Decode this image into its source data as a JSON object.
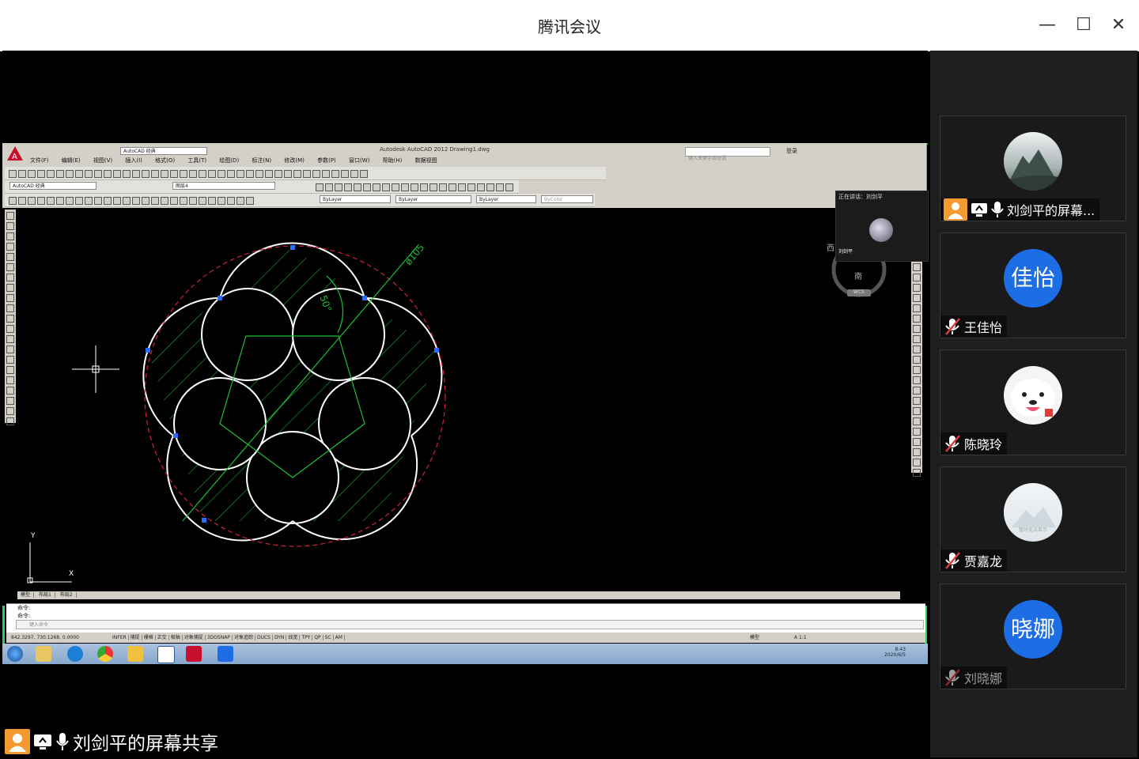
{
  "window": {
    "title": "腾讯会议",
    "controls": {
      "minimize": "—",
      "maximize": "☐",
      "close": "✕"
    }
  },
  "share": {
    "sharer_label": "刘剑平的屏幕共享",
    "speaking_label": "正在讲话：刘剑平",
    "mini_name": "刘剑平"
  },
  "autocad": {
    "logo_letter": "A",
    "workspace": "AutoCAD 经典",
    "title": "Autodesk AutoCAD 2012    Drawing1.dwg",
    "search_placeholder": "键入关键字或短语",
    "signin": "登录",
    "menu": [
      "文件(F)",
      "编辑(E)",
      "视图(V)",
      "插入(I)",
      "格式(O)",
      "工具(T)",
      "绘图(D)",
      "标注(N)",
      "修改(M)",
      "参数(P)",
      "窗口(W)",
      "帮助(H)",
      "数据视图"
    ],
    "workspace_combo": "AutoCAD 经典",
    "layer_combo": "图层4",
    "color_combo": "ByLayer",
    "linetype_combo": "ByLayer",
    "lineweight_combo": "ByLayer",
    "plotstyle_combo": "ByColor",
    "dimension_text_1": "ø105",
    "dimension_text_2": "50°",
    "viewcube_west": "西",
    "viewcube_south": "南",
    "wcs_label": "WCS",
    "ucs_y": "Y",
    "ucs_x": "X",
    "layout_tabs": [
      "模型",
      "布局1",
      "布局2"
    ],
    "command_lines": [
      "命令:",
      "命令:"
    ],
    "command_prompt": "键入命令",
    "coordinates": "842.3297, 730.1268, 0.0000",
    "status_modes": [
      "INFER",
      "捕捉",
      "栅格",
      "正交",
      "极轴",
      "对象捕捉",
      "3DOSNAP",
      "对象追踪",
      "DUCS",
      "DYN",
      "线宽",
      "TPY",
      "QP",
      "SC",
      "AM"
    ],
    "status_right": [
      "模型",
      "A 1:1"
    ],
    "tray_time": "8:43",
    "tray_date": "2020/6/5"
  },
  "participants": [
    {
      "name": "刘剑平的屏幕...",
      "avatar_type": "image",
      "mic": "on",
      "host": true,
      "sharing": true
    },
    {
      "name": "王佳怡",
      "avatar_text": "佳怡",
      "avatar_type": "text",
      "mic": "muted"
    },
    {
      "name": "陈晓玲",
      "avatar_type": "image",
      "mic": "muted"
    },
    {
      "name": "贾嘉龙",
      "avatar_type": "image",
      "avatar_caption": "暂时无法显示",
      "mic": "muted"
    },
    {
      "name": "刘晓娜",
      "avatar_text": "晓娜",
      "avatar_type": "text",
      "mic": "muted",
      "dim": true
    }
  ],
  "colors": {
    "accent_blue": "#1d6de5",
    "green_border": "#2dd05a",
    "host_orange": "#f39a30",
    "mute_red": "#e03a3a",
    "cad_hatch": "#1fbf3a",
    "cad_circle": "#ffffff",
    "cad_outer": "#d0213c",
    "cad_grip": "#2b6cff"
  },
  "icons": {
    "host": "host-person-icon",
    "screen_share": "screen-share-icon",
    "mic": "microphone-icon",
    "mic_muted": "microphone-muted-icon"
  }
}
